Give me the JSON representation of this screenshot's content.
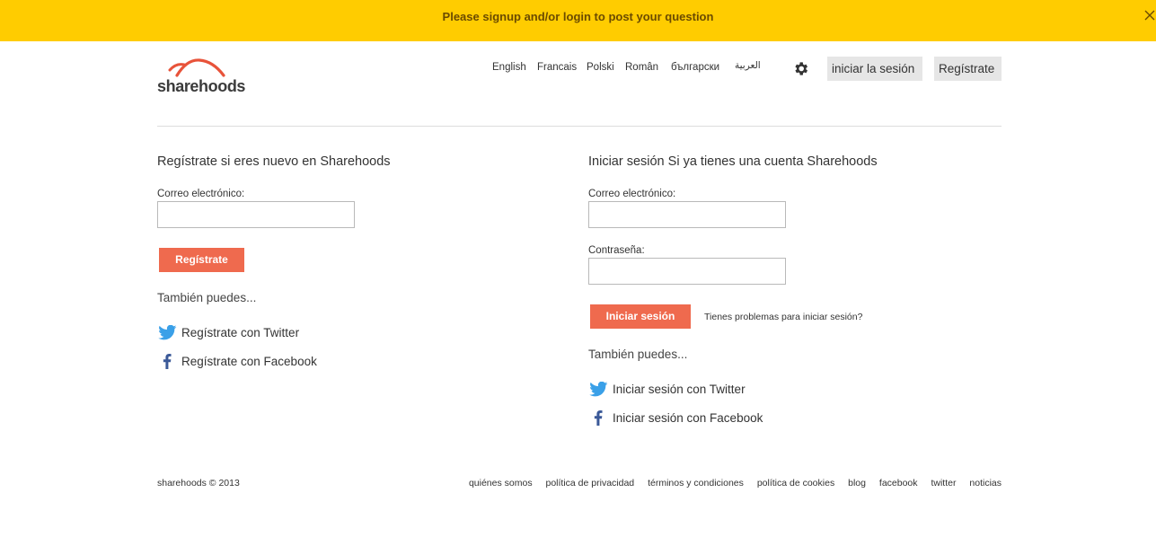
{
  "banner": {
    "text": "Please signup and/or login to post your question",
    "close_icon": "close-icon"
  },
  "logo": {
    "text": "sharehoods",
    "accent": "#e8533a"
  },
  "languages": [
    "English",
    "Francais",
    "Polski",
    "Român",
    "български",
    "العربية"
  ],
  "header": {
    "settings_icon": "gear-icon",
    "login_label": "iniciar la sesión",
    "register_label": "Regístrate"
  },
  "register": {
    "title": "Regístrate si eres nuevo en Sharehoods",
    "email_label": "Correo electrónico:",
    "email_value": "",
    "button_label": "Regístrate",
    "also_label": "También puedes...",
    "twitter_label": "Regístrate con Twitter",
    "facebook_label": "Regístrate con Facebook"
  },
  "login": {
    "title": "Iniciar sesión Si ya tienes una cuenta Sharehoods",
    "email_label": "Correo electrónico:",
    "email_value": "",
    "password_label": "Contraseña:",
    "password_value": "",
    "button_label": "Iniciar sesión",
    "trouble_label": "Tienes problemas para iniciar sesión?",
    "also_label": "También puedes...",
    "twitter_label": "Iniciar sesión con Twitter",
    "facebook_label": "Iniciar sesión con Facebook"
  },
  "footer": {
    "copyright": "sharehoods © 2013",
    "links": [
      "quiénes somos",
      "política de privacidad",
      "términos y condiciones",
      "política de cookies",
      "blog",
      "facebook",
      "twitter",
      "noticias"
    ]
  },
  "colors": {
    "banner": "#ffcc00",
    "accent_button": "#ef6a4e",
    "twitter": "#3aa0e8",
    "facebook": "#3b5998"
  }
}
